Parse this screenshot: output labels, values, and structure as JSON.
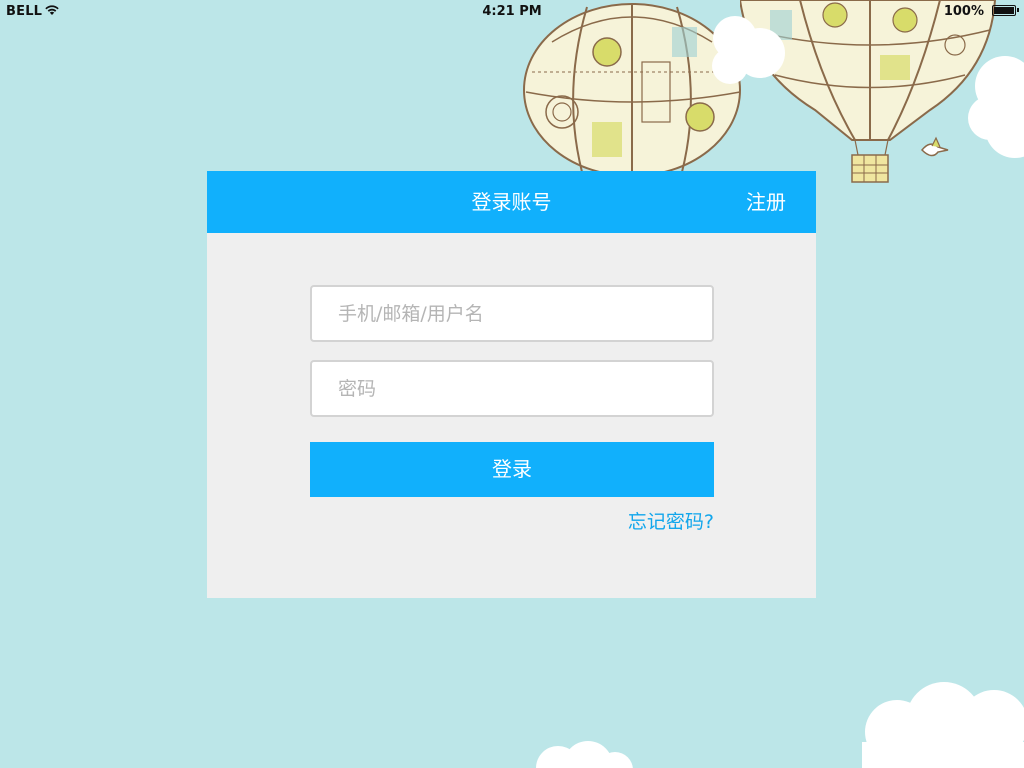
{
  "status_bar": {
    "carrier": "BELL",
    "time": "4:21 PM",
    "battery": "100%",
    "battery_level": 1.0
  },
  "header": {
    "title": "登录账号",
    "register_label": "注册"
  },
  "form": {
    "username_placeholder": "手机/邮箱/用户名",
    "password_placeholder": "密码",
    "username_value": "",
    "password_value": "",
    "login_label": "登录",
    "forgot_label": "忘记密码?"
  },
  "colors": {
    "background": "#bce6e8",
    "accent": "#11b0fc",
    "card": "#efefef",
    "link": "#11a6ec"
  },
  "icons": [
    "wifi-icon",
    "battery-icon",
    "hot-air-balloon",
    "bird",
    "cloud"
  ]
}
